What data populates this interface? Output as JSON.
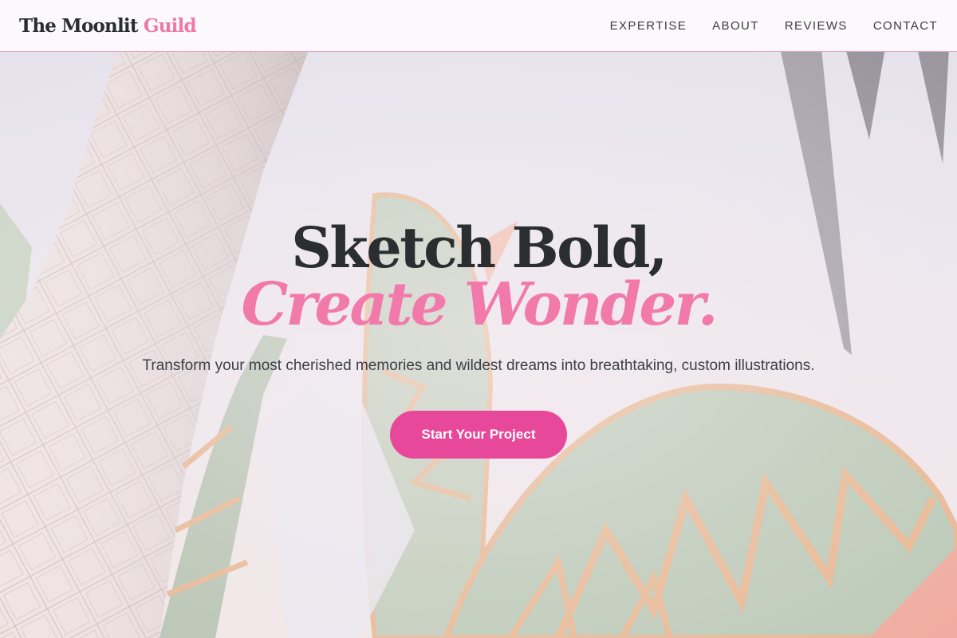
{
  "brand": {
    "name_main": "The Moonlit",
    "name_accent": "Guild"
  },
  "nav": {
    "items": [
      {
        "label": "EXPERTISE"
      },
      {
        "label": "ABOUT"
      },
      {
        "label": "REVIEWS"
      },
      {
        "label": "CONTACT"
      }
    ]
  },
  "hero": {
    "headline": "Sketch Bold,",
    "headline_accent": "Create Wonder.",
    "subtitle": "Transform your most cherished memories and wildest dreams into breathtaking, custom illustrations.",
    "cta_label": "Start Your Project"
  },
  "colors": {
    "accent": "#f27aab",
    "cta": "#e8489a",
    "text_dark": "#2b2e31",
    "header_border": "#e7a3bf"
  },
  "icons": {
    "hero_background": "illustrated-tropical-leaves-background"
  }
}
